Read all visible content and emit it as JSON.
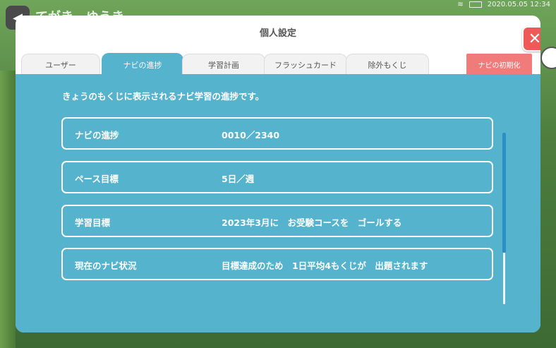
{
  "status": {
    "datetime": "2020.05.05 12:34"
  },
  "background": {
    "title": "てがき…ゆうき"
  },
  "modal": {
    "title": "個人設定",
    "close_label": "✕",
    "tabs": [
      "ユーザー",
      "ナビの進捗",
      "学習計画",
      "フラッシュカード",
      "除外もくじ"
    ],
    "active_tab": 1,
    "reset_label": "ナビの初期化",
    "description": "きょうのもくじに表示されるナビ学習の進捗です。",
    "rows": [
      {
        "label": "ナビの進捗",
        "value": "0010／2340"
      },
      {
        "label": "ペース目標",
        "value": "5日／週"
      },
      {
        "label": "学習目標",
        "value": "2023年3月に　お受験コースを　ゴールする"
      },
      {
        "label": "現在のナビ状況",
        "value": "目標達成のため　1日平均4もくじが　出題されます"
      }
    ]
  },
  "colors": {
    "panel": "#55b3cd",
    "accent_red": "#ee5a59",
    "reset": "#f17b7b"
  }
}
